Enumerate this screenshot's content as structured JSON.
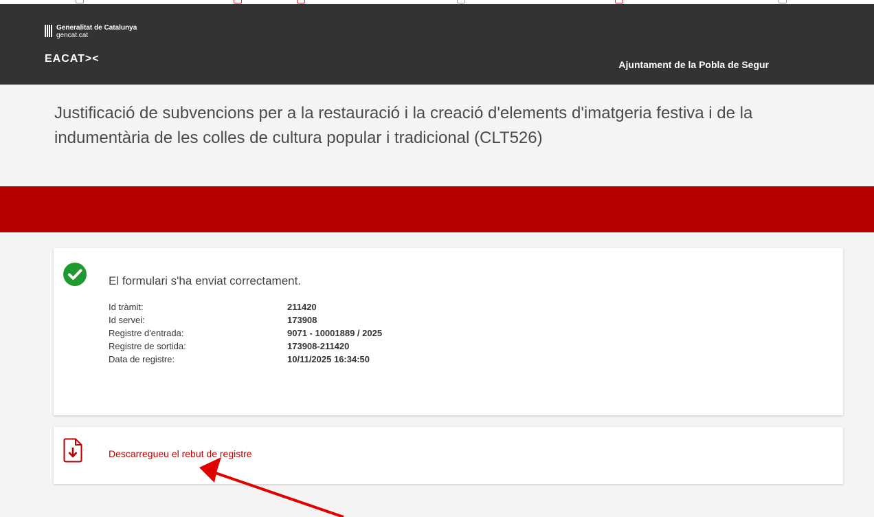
{
  "header": {
    "gencat_name": "Generalitat de Catalunya",
    "gencat_domain": "gencat.cat",
    "eacat_logo": "EACAT><",
    "organization": "Ajuntament de la Pobla de Segur"
  },
  "page": {
    "title": "Justificació de subvencions per a la restauració i la creació d'elements d'imatgeria festiva i de la indumentària de les colles de cultura popular i tradicional (CLT526)"
  },
  "result": {
    "icon": "check-circle-icon",
    "message": "El formulari s'ha enviat correctament.",
    "rows": [
      {
        "label": "Id tràmit:",
        "value": "211420"
      },
      {
        "label": "Id servei:",
        "value": "173908"
      },
      {
        "label": "Registre d'entrada:",
        "value": "9071 - 10001889 / 2025"
      },
      {
        "label": "Registre de sortida:",
        "value": "173908-211420"
      },
      {
        "label": "Data de registre:",
        "value": "10/11/2025 16:34:50"
      }
    ]
  },
  "download": {
    "icon": "pdf-download-icon",
    "label": "Descarregueu el rebut de registre"
  },
  "colors": {
    "header_bg": "#333333",
    "accent_red": "#b80000",
    "success_green": "#1f9a2e",
    "annotation_red": "#e00000"
  }
}
